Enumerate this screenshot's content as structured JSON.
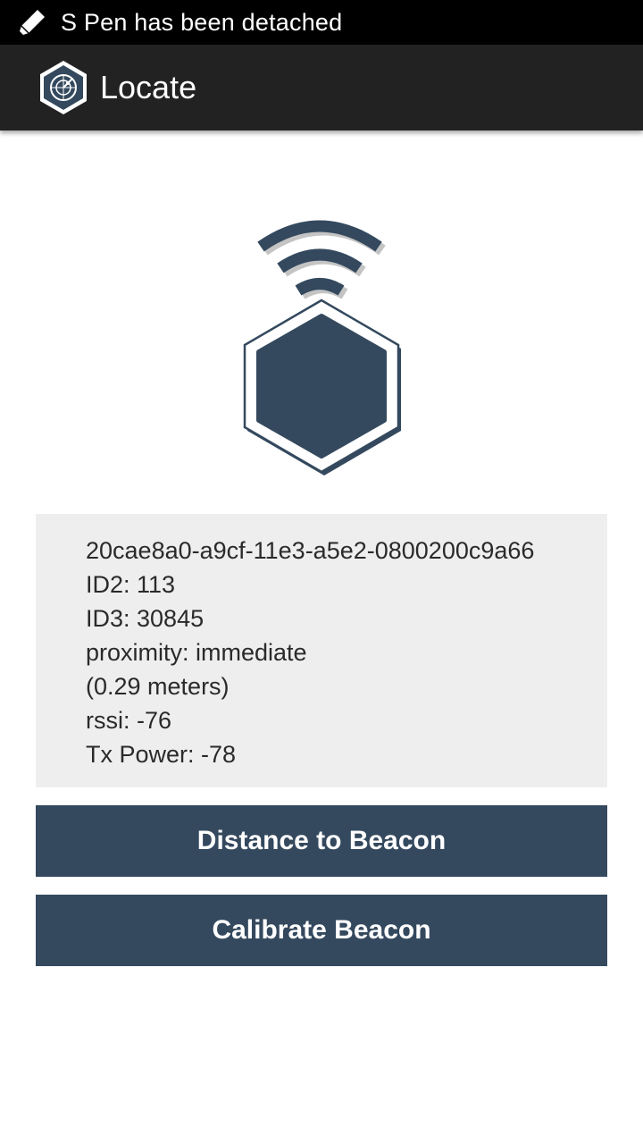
{
  "status_bar": {
    "notification_text": "S Pen has been detached",
    "icon": "pen-icon"
  },
  "action_bar": {
    "title": "Locate",
    "icon": "radar-hexagon-icon"
  },
  "illustration": {
    "icon": "beacon-signal-icon",
    "color": "#34495e"
  },
  "beacon_info": {
    "lines": [
      "20cae8a0-a9cf-11e3-a5e2-0800200c9a66",
      "ID2: 113",
      "ID3: 30845",
      "proximity: immediate",
      "(0.29 meters)",
      "rssi: -76",
      "Tx Power: -78"
    ]
  },
  "buttons": {
    "distance_label": "Distance to Beacon",
    "calibrate_label": "Calibrate Beacon"
  },
  "colors": {
    "accent": "#34495e",
    "panel_bg": "#eeeeee",
    "action_bar_bg": "#222222",
    "status_bar_bg": "#000000"
  }
}
